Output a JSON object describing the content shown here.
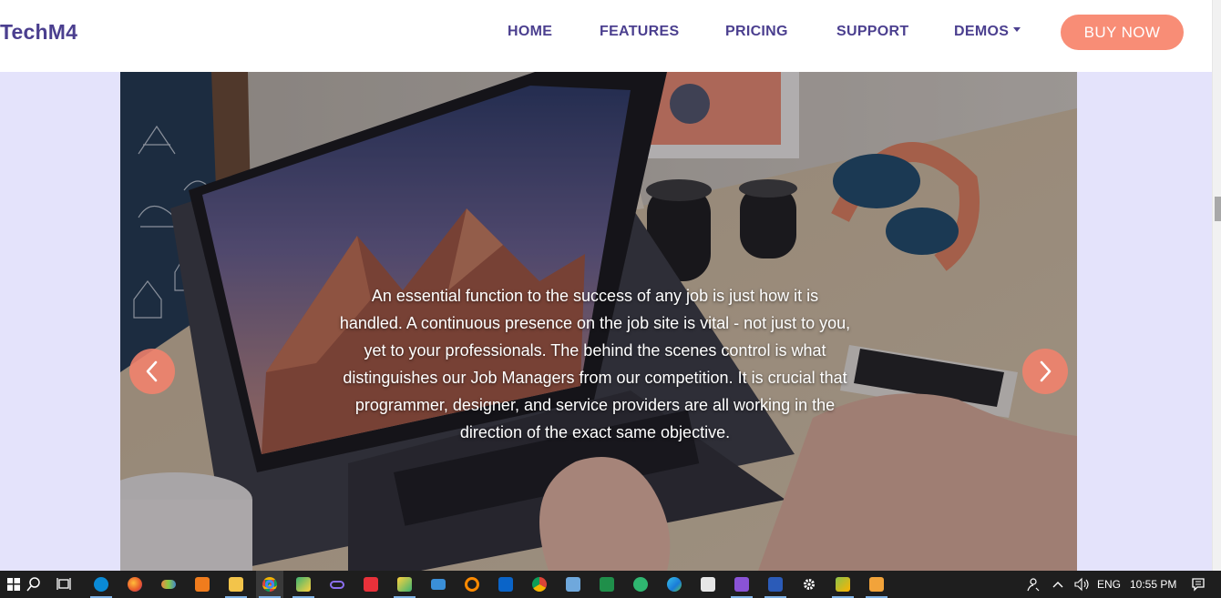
{
  "header": {
    "brand": "TechM4",
    "nav": [
      {
        "label": "HOME"
      },
      {
        "label": "FEATURES"
      },
      {
        "label": "PRICING"
      },
      {
        "label": "SUPPORT"
      },
      {
        "label": "DEMOS",
        "has_dropdown": true
      }
    ],
    "cta_label": "BUY NOW"
  },
  "hero": {
    "caption": "An essential function to the success of any job is just how it is handled. A continuous presence on the job site is vital - not just to you, yet to your professionals. The behind the scenes control is what distinguishes our Job Managers from our competition. It is crucial that programmer, designer, and service providers are all working in the direction of the exact same objective.",
    "prev_icon": "chevron-left-icon",
    "next_icon": "chevron-right-icon"
  },
  "taskbar": {
    "apps": [
      "start-icon",
      "search-icon",
      "task-view-icon",
      "skype-icon",
      "firefox-icon",
      "app-icon",
      "xampp-icon",
      "file-explorer-icon",
      "chrome-icon",
      "app-icon",
      "app-icon",
      "app-icon",
      "app-icon",
      "mail-icon",
      "search-app-icon",
      "outlook-icon",
      "chrome-icon",
      "app-icon",
      "app-icon",
      "app-icon",
      "edge-icon",
      "app-icon",
      "visual-studio-icon",
      "word-icon",
      "settings-icon",
      "app-icon",
      "sublime-icon"
    ],
    "language": "ENG",
    "time": "10:55 PM"
  },
  "colors": {
    "brand": "#4b3f8f",
    "accent": "#f88d76",
    "page_bg": "#e4e3fb",
    "taskbar": "#1e1e1e"
  }
}
